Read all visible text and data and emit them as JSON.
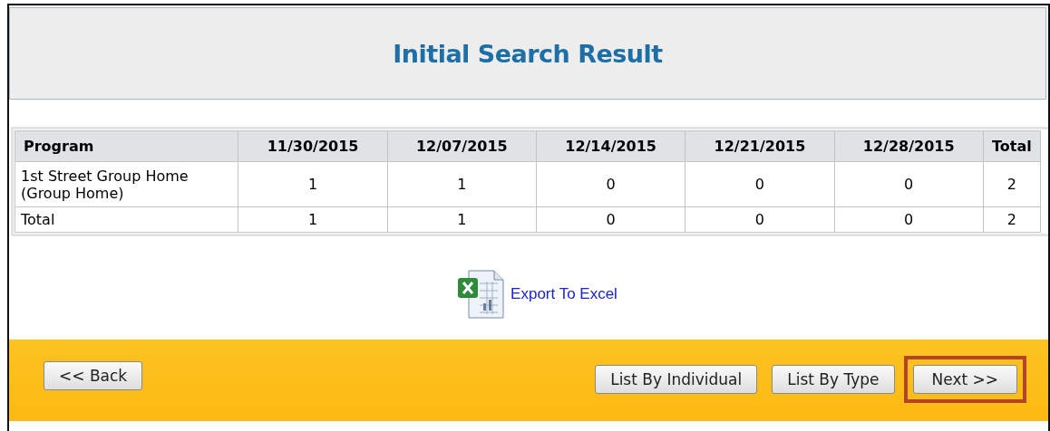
{
  "header": {
    "title": "Initial Search Result"
  },
  "table": {
    "columns": [
      "Program",
      "11/30/2015",
      "12/07/2015",
      "12/14/2015",
      "12/21/2015",
      "12/28/2015",
      "Total"
    ],
    "rows": [
      [
        "1st Street Group Home (Group Home)",
        "1",
        "1",
        "0",
        "0",
        "0",
        "2"
      ],
      [
        "Total",
        "1",
        "1",
        "0",
        "0",
        "0",
        "2"
      ]
    ]
  },
  "export_link": "Export To Excel",
  "footer": {
    "left_buttons": [
      {
        "label": "<< Back",
        "highlighted": false
      }
    ],
    "right_buttons": [
      {
        "label": "List By Individual",
        "highlighted": false
      },
      {
        "label": "List By Type",
        "highlighted": false
      },
      {
        "label": "Next >>",
        "highlighted": true
      }
    ]
  }
}
